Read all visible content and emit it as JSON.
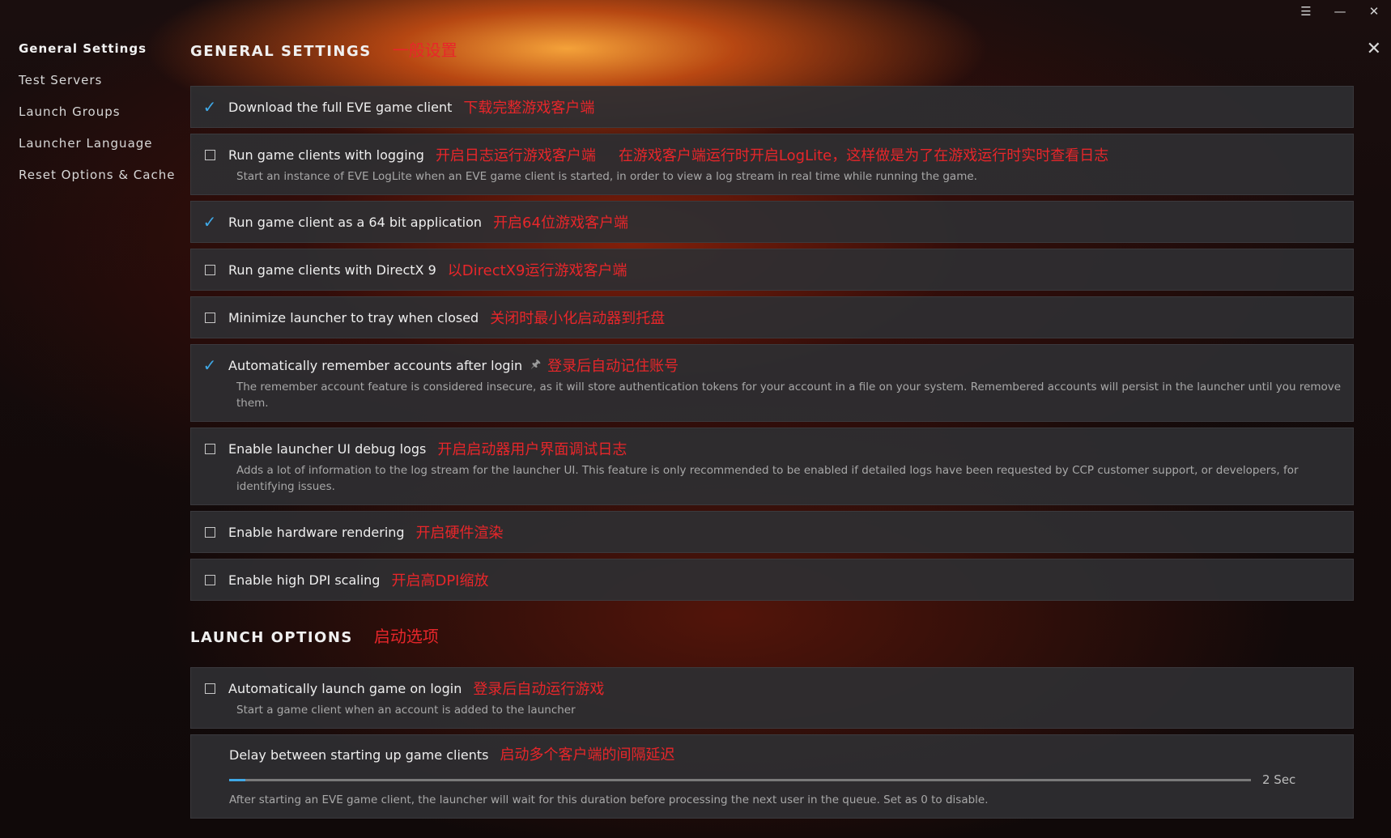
{
  "window": {
    "controls": [
      "menu-icon",
      "minimize-icon",
      "close-icon"
    ],
    "close_panel": "✕"
  },
  "sidebar": {
    "items": [
      {
        "label": "General Settings",
        "active": true
      },
      {
        "label": "Test Servers"
      },
      {
        "label": "Launch Groups"
      },
      {
        "label": "Launcher Language"
      },
      {
        "label": "Reset Options & Cache"
      }
    ]
  },
  "general": {
    "title": "GENERAL SETTINGS",
    "annotation": "一般设置",
    "options": [
      {
        "label": "Download the full EVE game client",
        "checked": true,
        "annotation": "下载完整游戏客户端"
      },
      {
        "label": "Run game clients with logging",
        "checked": false,
        "annotation": "开启日志运行游戏客户端",
        "annotation2": "在游戏客户端运行时开启LogLite，这样做是为了在游戏运行时实时查看日志",
        "description": "Start an instance of EVE LogLite when an EVE game client is started, in order to view a log stream in real time while running the game."
      },
      {
        "label": "Run game client as a 64 bit application",
        "checked": true,
        "annotation": "开启64位游戏客户端"
      },
      {
        "label": "Run game clients with DirectX 9",
        "checked": false,
        "annotation": "以DirectX9运行游戏客户端"
      },
      {
        "label": "Minimize launcher to tray when closed",
        "checked": false,
        "annotation": "关闭时最小化启动器到托盘"
      },
      {
        "label": "Automatically remember accounts after login",
        "checked": true,
        "annotation": "登录后自动记住账号",
        "description": "The remember account feature is considered insecure, as it will store authentication tokens for your account in a file on your system. Remembered accounts will persist in the launcher until you remove them."
      },
      {
        "label": "Enable launcher UI debug logs",
        "checked": false,
        "annotation": "开启启动器用户界面调试日志",
        "description": "Adds a lot of information to the log stream for the launcher UI. This feature is only recommended to be enabled if detailed logs have been requested by CCP customer support, or developers, for identifying issues."
      },
      {
        "label": "Enable hardware rendering",
        "checked": false,
        "annotation": "开启硬件渲染"
      },
      {
        "label": "Enable high DPI scaling",
        "checked": false,
        "annotation": "开启高DPI缩放"
      }
    ]
  },
  "launch": {
    "title": "LAUNCH OPTIONS",
    "annotation": "启动选项",
    "auto_launch": {
      "label": "Automatically launch game on login",
      "checked": false,
      "annotation": "登录后自动运行游戏",
      "description": "Start a game client when an account is added to the launcher"
    },
    "delay": {
      "label": "Delay between starting up game clients",
      "annotation": "启动多个客户端的间隔延迟",
      "value": "2 Sec",
      "fraction": 0.016,
      "description": "After starting an EVE game client, the launcher will wait for this duration before processing the next user in the queue. Set as 0 to disable."
    }
  },
  "colors": {
    "accent": "#3fa8e6",
    "annotation": "#e8262a",
    "card": "#2e2e32"
  }
}
